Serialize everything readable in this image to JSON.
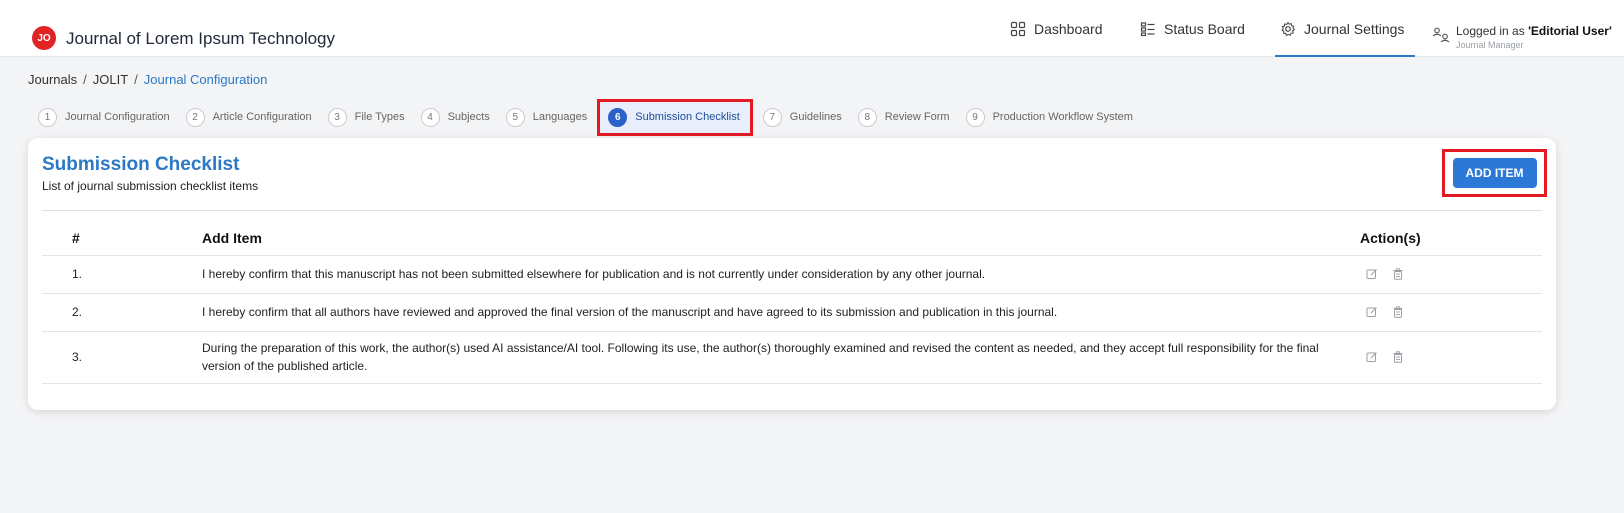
{
  "header": {
    "logo_text": "JO",
    "app_title": "Journal of Lorem Ipsum Technology",
    "nav": [
      {
        "label": "Dashboard",
        "icon": "grid-icon"
      },
      {
        "label": "Status Board",
        "icon": "board-icon"
      },
      {
        "label": "Journal Settings",
        "icon": "gear-icon"
      }
    ],
    "user": {
      "prefix": "Logged in as ",
      "name": "'Editorial User'",
      "role": "Journal Manager"
    }
  },
  "breadcrumb": {
    "items": [
      "Journals",
      "JOLIT",
      "Journal Configuration"
    ],
    "separator": "/"
  },
  "steps": [
    {
      "num": "1",
      "label": "Journal Configuration"
    },
    {
      "num": "2",
      "label": "Article Configuration"
    },
    {
      "num": "3",
      "label": "File Types"
    },
    {
      "num": "4",
      "label": "Subjects"
    },
    {
      "num": "5",
      "label": "Languages"
    },
    {
      "num": "6",
      "label": "Submission Checklist"
    },
    {
      "num": "7",
      "label": "Guidelines"
    },
    {
      "num": "8",
      "label": "Review Form"
    },
    {
      "num": "9",
      "label": "Production Workflow System"
    }
  ],
  "active_step": "6",
  "card": {
    "title": "Submission Checklist",
    "subtitle": "List of journal submission checklist items",
    "add_button": "ADD ITEM",
    "columns": [
      "#",
      "Add Item",
      "Action(s)"
    ],
    "rows": [
      {
        "num": "1.",
        "text": "I hereby confirm that this manuscript has not been submitted elsewhere for publication and is not currently under consideration by any other journal."
      },
      {
        "num": "2.",
        "text": "I hereby confirm that all authors have reviewed and approved the final version of the manuscript and have agreed to its submission and publication in this journal."
      },
      {
        "num": "3.",
        "text": "During the preparation of this work, the author(s) used AI assistance/AI tool. Following its use, the author(s) thoroughly examined and revised the content as needed, and they accept full responsibility for the final version of the published article."
      }
    ]
  },
  "colors": {
    "accent": "#2b78c5",
    "logo": "#e02424",
    "highlight": "#e21b23"
  }
}
